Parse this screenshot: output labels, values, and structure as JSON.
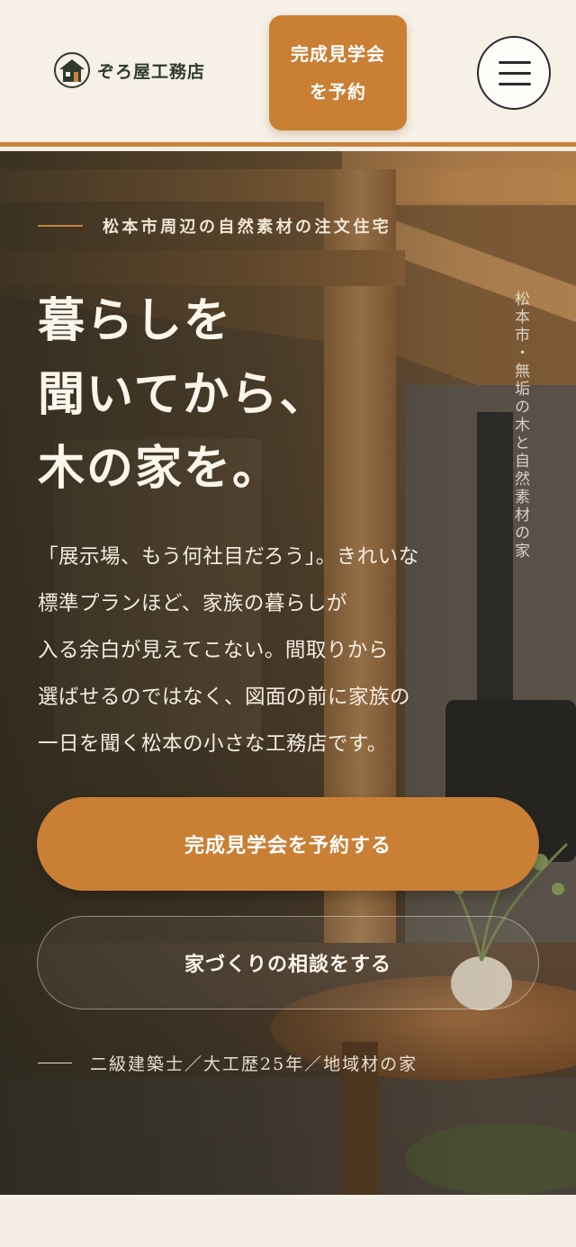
{
  "header": {
    "logo_text": "ぞろ屋工務店",
    "cta_label": "完成見学会を予約",
    "menu_icon": "hamburger-menu-icon"
  },
  "hero": {
    "eyebrow": "松本市周辺の自然素材の注文住宅",
    "headline_lines": [
      "暮らしを",
      "聞いてから、",
      "木の家を。"
    ],
    "vertical_text": "松本市・無垢の木と自然素材の家",
    "body_lines": [
      "「展示場、もう何社目だろう」。きれいな",
      "標準プランほど、家族の暮らしが",
      "入る余白が見えてこない。間取りから",
      "選ばせるのではなく、図面の前に家族の",
      "一日を聞く松本の小さな工務店です。"
    ],
    "cta_primary": "完成見学会を予約する",
    "cta_secondary": "家づくりの相談をする",
    "credentials": "二級建築士／大工歴25年／地域材の家"
  },
  "colors": {
    "accent": "#c97f34",
    "header_bg": "#f6f0e6",
    "hero_text": "#fbf6ec"
  }
}
